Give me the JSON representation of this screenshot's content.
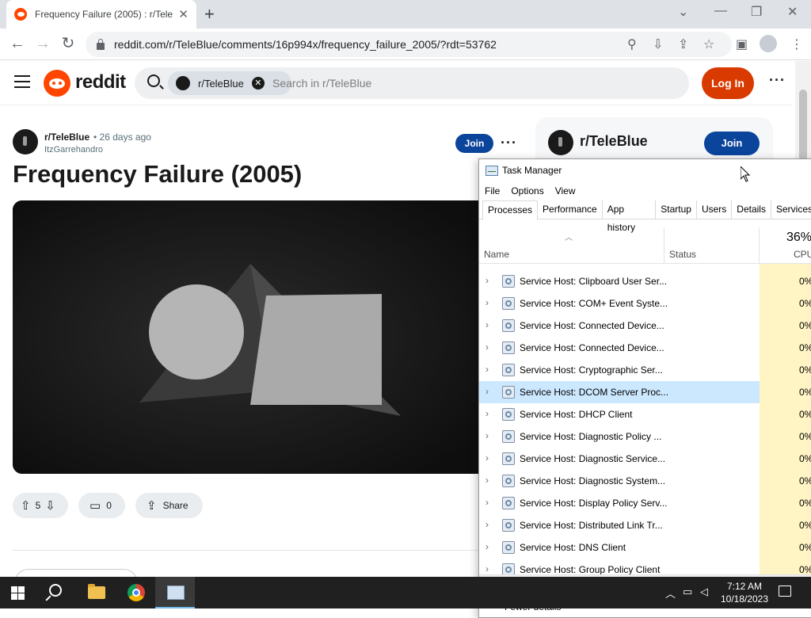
{
  "browser": {
    "tab_title": "Frequency Failure (2005) : r/TeleBlue",
    "new_tab": "+",
    "url": "reddit.com/r/TeleBlue/comments/16p994x/frequency_failure_2005/?rdt=53762"
  },
  "reddit": {
    "wordmark": "reddit",
    "search_chip": "r/TeleBlue",
    "search_placeholder": "Search in r/TeleBlue",
    "login_label": "Log In",
    "brand_color": "#ff4500"
  },
  "post": {
    "subreddit": "r/TeleBlue",
    "time": "• 26 days ago",
    "author": "ItzGarrehandro",
    "join_label": "Join",
    "title": "Frequency Failure (2005)",
    "upvotes": "5",
    "comments": "0",
    "share_label": "Share"
  },
  "sidebar": {
    "name": "r/TeleBlue",
    "join_label": "Join"
  },
  "task_manager": {
    "title": "Task Manager",
    "menu": [
      "File",
      "Options",
      "View"
    ],
    "tabs": [
      "Processes",
      "Performance",
      "App history",
      "Startup",
      "Users",
      "Details",
      "Services"
    ],
    "columns": {
      "name": "Name",
      "status": "Status",
      "cpu_total": "36%",
      "cpu": "CPU"
    },
    "processes": [
      {
        "name": "Service Host: Clipboard User Ser...",
        "cpu": "0%"
      },
      {
        "name": "Service Host: COM+ Event Syste...",
        "cpu": "0%"
      },
      {
        "name": "Service Host: Connected Device...",
        "cpu": "0%"
      },
      {
        "name": "Service Host: Connected Device...",
        "cpu": "0%"
      },
      {
        "name": "Service Host: Cryptographic Ser...",
        "cpu": "0%"
      },
      {
        "name": "Service Host: DCOM Server Proc...",
        "cpu": "0%",
        "selected": true
      },
      {
        "name": "Service Host: DHCP Client",
        "cpu": "0%"
      },
      {
        "name": "Service Host: Diagnostic Policy ...",
        "cpu": "0%"
      },
      {
        "name": "Service Host: Diagnostic Service...",
        "cpu": "0%"
      },
      {
        "name": "Service Host: Diagnostic System...",
        "cpu": "0%"
      },
      {
        "name": "Service Host: Display Policy Serv...",
        "cpu": "0%"
      },
      {
        "name": "Service Host: Distributed Link Tr...",
        "cpu": "0%"
      },
      {
        "name": "Service Host: DNS Client",
        "cpu": "0%"
      },
      {
        "name": "Service Host: Group Policy Client",
        "cpu": "0%"
      }
    ],
    "fewer_details": "Fewer details"
  },
  "taskbar": {
    "time": "7:12 AM",
    "date": "10/18/2023"
  }
}
